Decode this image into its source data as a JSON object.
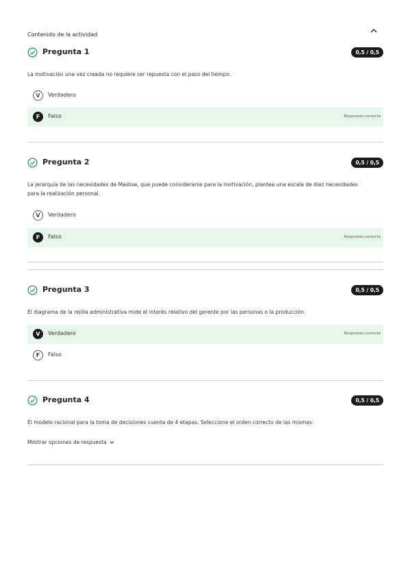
{
  "header": {
    "title": "Contenido de la actividad"
  },
  "questions": [
    {
      "title": "Pregunta 1",
      "score": "0,5 / 0,5",
      "text": "La motivación una vez creada no requiere ser repuesta con el paso del tiempo.",
      "options": [
        {
          "letter": "V",
          "label": "Verdadero",
          "feedback": ""
        },
        {
          "letter": "F",
          "label": "Falso",
          "feedback": "Respuesta correcta"
        }
      ]
    },
    {
      "title": "Pregunta 2",
      "score": "0,5 / 0,5",
      "text": "La jerarquía de las necesidades de Maslow, que puede considerarse para la motivación, plantea una escala de diez necesidades para la realización personal.",
      "options": [
        {
          "letter": "V",
          "label": "Verdadero",
          "feedback": ""
        },
        {
          "letter": "F",
          "label": "Falso",
          "feedback": "Respuesta correcta"
        }
      ]
    },
    {
      "title": "Pregunta 3",
      "score": "0,5 / 0,5",
      "text": "El diagrama de la rejilla administrativa mide el interés relativo del gerente por las personas o la producción.",
      "options": [
        {
          "letter": "V",
          "label": "Verdadero",
          "feedback": "Respuesta correcta"
        },
        {
          "letter": "F",
          "label": "Falso",
          "feedback": ""
        }
      ]
    },
    {
      "title": "Pregunta 4",
      "score": "0,5 / 0,5",
      "text": "El modelo racional para la toma de decisiones cuenta de 4 etapas. Seleccione el orden correcto de las mismas:",
      "show_options": "Mostrar opciones de respuesta"
    }
  ],
  "colors": {
    "correct_bg": "#e6f7ec",
    "check_green": "#1aa34a",
    "badge_bg": "#1b1b1b"
  },
  "icons": {
    "collapse": "chevron-up-icon",
    "check": "check-circle-icon",
    "expand": "chevron-down-icon"
  }
}
